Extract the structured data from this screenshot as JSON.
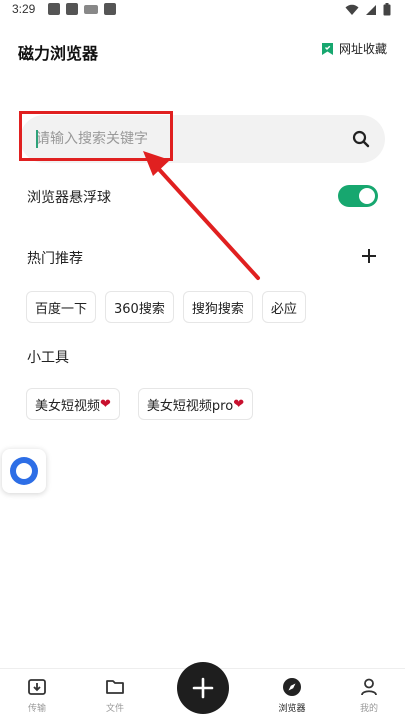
{
  "status_bar": {
    "time": "3:29"
  },
  "header": {
    "title": "磁力浏览器",
    "bookmarks_label": "网址收藏"
  },
  "search": {
    "placeholder": "请输入搜索关键字",
    "value": ""
  },
  "settings": {
    "floating_ball_label": "浏览器悬浮球",
    "floating_ball_enabled": true
  },
  "hot": {
    "title": "热门推荐",
    "items": [
      "百度一下",
      "360搜索",
      "搜狗搜索",
      "必应"
    ]
  },
  "tools": {
    "title": "小工具",
    "items": [
      "美女短视频",
      "美女短视频pro"
    ],
    "heart": "❤"
  },
  "bottom_nav": {
    "items": [
      {
        "label": "传输",
        "icon": "download-tray-icon"
      },
      {
        "label": "文件",
        "icon": "folder-icon"
      },
      {
        "label": "浏览器",
        "icon": "compass-icon"
      },
      {
        "label": "我的",
        "icon": "person-icon"
      }
    ],
    "active": "浏览器"
  },
  "colors": {
    "accent": "#17a76f",
    "annotation": "#e02020",
    "fab": "#1e1e1e",
    "float_ball": "#2d6ee6"
  }
}
